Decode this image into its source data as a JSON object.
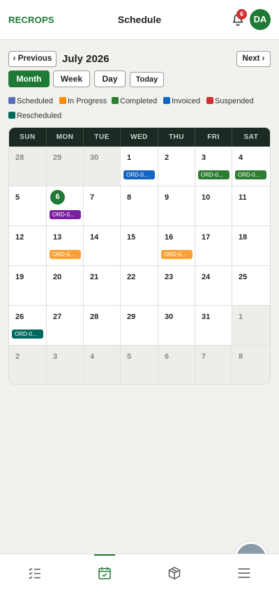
{
  "app": {
    "brand": "RECROPS",
    "title": "Schedule",
    "notification_count": "6",
    "avatar_initials": "DA"
  },
  "nav": {
    "prev_label": "‹ Previous",
    "next_label": "Next ›",
    "month_label": "July 2026"
  },
  "views": {
    "month": "Month",
    "week": "Week",
    "day": "Day",
    "today": "Today",
    "active": "Month"
  },
  "legend": [
    {
      "label": "Scheduled",
      "color": "#5c6bc0"
    },
    {
      "label": "In Progress",
      "color": "#fb8c00"
    },
    {
      "label": "Completed",
      "color": "#2e7d32"
    },
    {
      "label": "Invoiced",
      "color": "#1565c0"
    },
    {
      "label": "Suspended",
      "color": "#d32f2f"
    },
    {
      "label": "Rescheduled",
      "color": "#00695c"
    }
  ],
  "calendar": {
    "weekdays": [
      "SUN",
      "MON",
      "TUE",
      "WED",
      "THU",
      "FRI",
      "SAT"
    ],
    "today": "6",
    "weeks": [
      [
        {
          "d": "28",
          "out": true
        },
        {
          "d": "29",
          "out": true
        },
        {
          "d": "30",
          "out": true
        },
        {
          "d": "1",
          "ev": "ORD-0...",
          "evcolor": "#1565c0"
        },
        {
          "d": "2"
        },
        {
          "d": "3",
          "ev": "ORD-0...",
          "evcolor": "#2e7d32"
        },
        {
          "d": "4",
          "ev": "ORD-0...",
          "evcolor": "#2e7d32"
        }
      ],
      [
        {
          "d": "5"
        },
        {
          "d": "6",
          "today": true,
          "ev": "ORD-0...",
          "evcolor": "#7b1fa2"
        },
        {
          "d": "7"
        },
        {
          "d": "8"
        },
        {
          "d": "9"
        },
        {
          "d": "10"
        },
        {
          "d": "11"
        }
      ],
      [
        {
          "d": "12"
        },
        {
          "d": "13",
          "ev": "ORD-0...",
          "evcolor": "#f9a133"
        },
        {
          "d": "14"
        },
        {
          "d": "15"
        },
        {
          "d": "16",
          "ev": "ORD-0...",
          "evcolor": "#f9a133"
        },
        {
          "d": "17"
        },
        {
          "d": "18"
        }
      ],
      [
        {
          "d": "19"
        },
        {
          "d": "20"
        },
        {
          "d": "21"
        },
        {
          "d": "22"
        },
        {
          "d": "23"
        },
        {
          "d": "24"
        },
        {
          "d": "25"
        }
      ],
      [
        {
          "d": "26",
          "ev": "ORD-0...",
          "evcolor": "#00695c"
        },
        {
          "d": "27"
        },
        {
          "d": "28"
        },
        {
          "d": "29"
        },
        {
          "d": "30"
        },
        {
          "d": "31"
        },
        {
          "d": "1",
          "out": true
        }
      ],
      [
        {
          "d": "2",
          "out": true
        },
        {
          "d": "3",
          "out": true
        },
        {
          "d": "4",
          "out": true
        },
        {
          "d": "5",
          "out": true
        },
        {
          "d": "6",
          "out": true
        },
        {
          "d": "7",
          "out": true
        },
        {
          "d": "8",
          "out": true
        }
      ]
    ]
  },
  "bottom_nav": [
    {
      "icon": "checklist-icon"
    },
    {
      "icon": "calendar-check-icon",
      "active": true
    },
    {
      "icon": "package-icon"
    },
    {
      "icon": "menu-icon"
    }
  ]
}
